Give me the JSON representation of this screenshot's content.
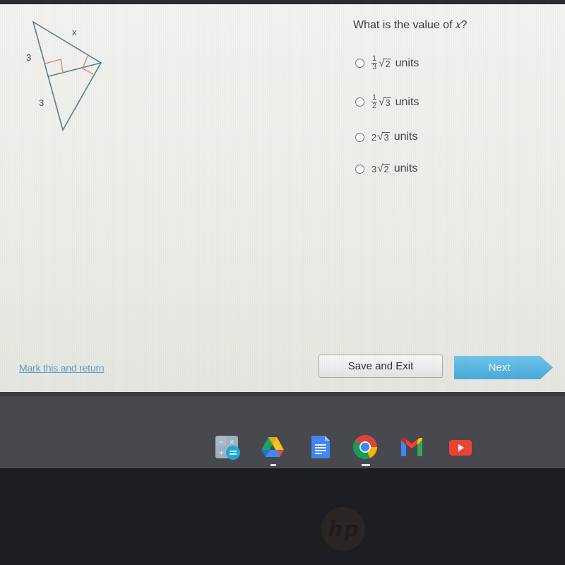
{
  "figure": {
    "labels": {
      "top_side": "x",
      "upper_left": "3",
      "lower_left": "3"
    },
    "line_color": "#5f7c8e",
    "marker_color": "#e0876a"
  },
  "question": {
    "prefix": "What is the value of ",
    "variable": "x",
    "suffix": "?"
  },
  "options": [
    {
      "fraction_num": "1",
      "fraction_den": "3",
      "radicand": "2",
      "unit": "units"
    },
    {
      "fraction_num": "1",
      "fraction_den": "2",
      "radicand": "3",
      "unit": "units"
    },
    {
      "coefficient": "2",
      "radicand": "3",
      "unit": "units"
    },
    {
      "coefficient": "3",
      "radicand": "2",
      "unit": "units"
    }
  ],
  "footer": {
    "mark_link": "Mark this and return",
    "save_button": "Save and Exit",
    "next_button": "Next"
  },
  "shelf": {
    "apps": [
      "calculator",
      "google-drive",
      "google-docs",
      "google-chrome",
      "gmail",
      "youtube"
    ]
  },
  "bezel": {
    "logo": "hp"
  },
  "colors": {
    "link": "#5a9ec6",
    "next_button": "#4aa9d9",
    "shelf": "#47494e"
  }
}
